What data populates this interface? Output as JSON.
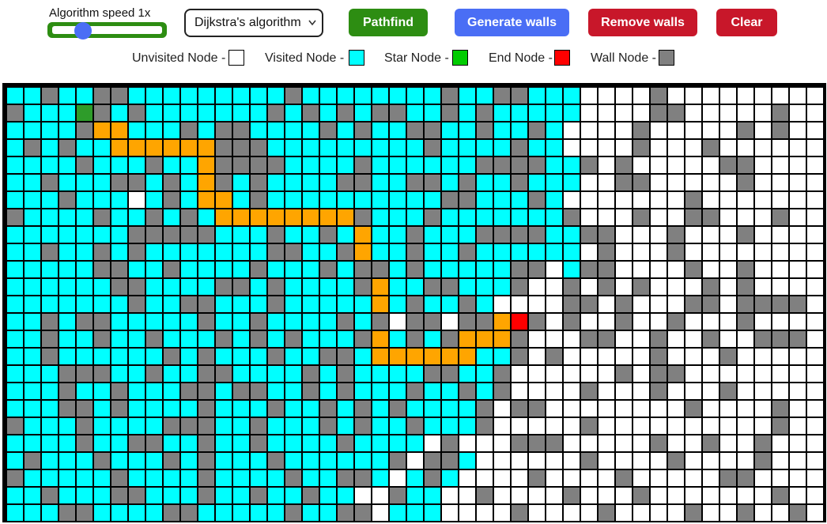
{
  "toolbar": {
    "speed_label": "Algorithm speed 1x",
    "speed_value": 0.25,
    "algorithm_selected": "Dijkstra's algorithm",
    "pathfind_label": "Pathfind",
    "generate_walls_label": "Generate walls",
    "remove_walls_label": "Remove walls",
    "clear_label": "Clear"
  },
  "legend": {
    "unvisited": "Unvisited Node -",
    "visited": "Visited Node -",
    "star": "Star Node -",
    "end": "End Node -",
    "wall": "Wall Node -"
  },
  "colors": {
    "unvisited": "#ffffff",
    "visited": "#00ffff",
    "star": "#00cc00",
    "start_cell": "#2e9c2a",
    "end": "#ff0000",
    "wall": "#808080",
    "path": "#ffa500",
    "pathfind_button": "#2d8d12",
    "generate_button": "#4a6ef5",
    "remove_button": "#c8172a",
    "clear_button": "#c8172a"
  },
  "grid": {
    "columns": 47,
    "rows": 25,
    "start": [
      1,
      4
    ],
    "end": [
      13,
      29
    ],
    "path": [
      [
        1,
        5
      ],
      [
        2,
        5
      ],
      [
        2,
        6
      ],
      [
        3,
        6
      ],
      [
        3,
        7
      ],
      [
        3,
        8
      ],
      [
        3,
        9
      ],
      [
        3,
        10
      ],
      [
        3,
        11
      ],
      [
        4,
        11
      ],
      [
        5,
        11
      ],
      [
        6,
        11
      ],
      [
        6,
        12
      ],
      [
        7,
        12
      ],
      [
        7,
        13
      ],
      [
        7,
        14
      ],
      [
        7,
        15
      ],
      [
        7,
        16
      ],
      [
        7,
        17
      ],
      [
        7,
        18
      ],
      [
        7,
        19
      ],
      [
        7,
        20
      ],
      [
        8,
        20
      ],
      [
        9,
        20
      ],
      [
        10,
        20
      ],
      [
        11,
        20
      ],
      [
        11,
        21
      ],
      [
        12,
        21
      ],
      [
        13,
        21
      ],
      [
        14,
        21
      ],
      [
        15,
        21
      ],
      [
        15,
        22
      ],
      [
        15,
        23
      ],
      [
        15,
        24
      ],
      [
        15,
        25
      ],
      [
        15,
        26
      ],
      [
        14,
        26
      ],
      [
        14,
        27
      ],
      [
        14,
        28
      ],
      [
        13,
        28
      ]
    ],
    "walls": [
      [
        0,
        2
      ],
      [
        0,
        5
      ],
      [
        0,
        6
      ],
      [
        0,
        16
      ],
      [
        0,
        25
      ],
      [
        0,
        28
      ],
      [
        0,
        29
      ],
      [
        0,
        37
      ],
      [
        1,
        0
      ],
      [
        1,
        5
      ],
      [
        1,
        7
      ],
      [
        1,
        15
      ],
      [
        1,
        17
      ],
      [
        1,
        19
      ],
      [
        1,
        21
      ],
      [
        1,
        22
      ],
      [
        1,
        25
      ],
      [
        1,
        27
      ],
      [
        1,
        37
      ],
      [
        1,
        38
      ],
      [
        1,
        44
      ],
      [
        2,
        4
      ],
      [
        2,
        10
      ],
      [
        2,
        12
      ],
      [
        2,
        13
      ],
      [
        2,
        18
      ],
      [
        2,
        20
      ],
      [
        2,
        23
      ],
      [
        2,
        24
      ],
      [
        2,
        27
      ],
      [
        2,
        30
      ],
      [
        2,
        36
      ],
      [
        2,
        42
      ],
      [
        2,
        44
      ],
      [
        3,
        1
      ],
      [
        3,
        3
      ],
      [
        3,
        12
      ],
      [
        3,
        13
      ],
      [
        3,
        14
      ],
      [
        3,
        24
      ],
      [
        3,
        29
      ],
      [
        3,
        36
      ],
      [
        3,
        40
      ],
      [
        4,
        4
      ],
      [
        4,
        8
      ],
      [
        4,
        12
      ],
      [
        4,
        13
      ],
      [
        4,
        14
      ],
      [
        4,
        15
      ],
      [
        4,
        20
      ],
      [
        4,
        27
      ],
      [
        4,
        28
      ],
      [
        4,
        29
      ],
      [
        4,
        30
      ],
      [
        4,
        33
      ],
      [
        4,
        35
      ],
      [
        4,
        41
      ],
      [
        4,
        42
      ],
      [
        5,
        2
      ],
      [
        5,
        6
      ],
      [
        5,
        7
      ],
      [
        5,
        9
      ],
      [
        5,
        12
      ],
      [
        5,
        14
      ],
      [
        5,
        19
      ],
      [
        5,
        20
      ],
      [
        5,
        23
      ],
      [
        5,
        24
      ],
      [
        5,
        26
      ],
      [
        5,
        29
      ],
      [
        5,
        35
      ],
      [
        5,
        36
      ],
      [
        5,
        42
      ],
      [
        6,
        3
      ],
      [
        6,
        9
      ],
      [
        6,
        14
      ],
      [
        6,
        25
      ],
      [
        6,
        26
      ],
      [
        6,
        30
      ],
      [
        6,
        39
      ],
      [
        7,
        0
      ],
      [
        7,
        5
      ],
      [
        7,
        8
      ],
      [
        7,
        10
      ],
      [
        7,
        20
      ],
      [
        7,
        24
      ],
      [
        7,
        32
      ],
      [
        7,
        36
      ],
      [
        7,
        39
      ],
      [
        7,
        40
      ],
      [
        7,
        44
      ],
      [
        8,
        7
      ],
      [
        8,
        8
      ],
      [
        8,
        9
      ],
      [
        8,
        10
      ],
      [
        8,
        11
      ],
      [
        8,
        15
      ],
      [
        8,
        18
      ],
      [
        8,
        23
      ],
      [
        8,
        27
      ],
      [
        8,
        28
      ],
      [
        8,
        29
      ],
      [
        8,
        30
      ],
      [
        8,
        33
      ],
      [
        8,
        34
      ],
      [
        8,
        38
      ],
      [
        8,
        42
      ],
      [
        9,
        2
      ],
      [
        9,
        5
      ],
      [
        9,
        7
      ],
      [
        9,
        15
      ],
      [
        9,
        16
      ],
      [
        9,
        19
      ],
      [
        9,
        23
      ],
      [
        9,
        26
      ],
      [
        9,
        34
      ],
      [
        9,
        38
      ],
      [
        10,
        5
      ],
      [
        10,
        6
      ],
      [
        10,
        9
      ],
      [
        10,
        14
      ],
      [
        10,
        18
      ],
      [
        10,
        20
      ],
      [
        10,
        21
      ],
      [
        10,
        23
      ],
      [
        10,
        29
      ],
      [
        10,
        30
      ],
      [
        10,
        33
      ],
      [
        10,
        34
      ],
      [
        10,
        39
      ],
      [
        10,
        42
      ],
      [
        11,
        6
      ],
      [
        11,
        7
      ],
      [
        11,
        12
      ],
      [
        11,
        13
      ],
      [
        11,
        15
      ],
      [
        11,
        20
      ],
      [
        11,
        24
      ],
      [
        11,
        25
      ],
      [
        11,
        29
      ],
      [
        11,
        32
      ],
      [
        11,
        34
      ],
      [
        11,
        36
      ],
      [
        11,
        40
      ],
      [
        11,
        42
      ],
      [
        12,
        7
      ],
      [
        12,
        10
      ],
      [
        12,
        11
      ],
      [
        12,
        15
      ],
      [
        12,
        23
      ],
      [
        12,
        26
      ],
      [
        12,
        32
      ],
      [
        12,
        33
      ],
      [
        12,
        35
      ],
      [
        12,
        39
      ],
      [
        12,
        40
      ],
      [
        12,
        42
      ],
      [
        12,
        43
      ],
      [
        12,
        44
      ],
      [
        12,
        45
      ],
      [
        13,
        2
      ],
      [
        13,
        4
      ],
      [
        13,
        5
      ],
      [
        13,
        11
      ],
      [
        13,
        14
      ],
      [
        13,
        19
      ],
      [
        13,
        21
      ],
      [
        13,
        23
      ],
      [
        13,
        24
      ],
      [
        13,
        26
      ],
      [
        13,
        27
      ],
      [
        13,
        30
      ],
      [
        13,
        32
      ],
      [
        13,
        35
      ],
      [
        13,
        38
      ],
      [
        13,
        42
      ],
      [
        14,
        2
      ],
      [
        14,
        5
      ],
      [
        14,
        8
      ],
      [
        14,
        12
      ],
      [
        14,
        14
      ],
      [
        14,
        16
      ],
      [
        14,
        20
      ],
      [
        14,
        23
      ],
      [
        14,
        25
      ],
      [
        14,
        29
      ],
      [
        14,
        33
      ],
      [
        14,
        34
      ],
      [
        14,
        37
      ],
      [
        14,
        40
      ],
      [
        14,
        43
      ],
      [
        14,
        44
      ],
      [
        14,
        45
      ],
      [
        15,
        2
      ],
      [
        15,
        9
      ],
      [
        15,
        11
      ],
      [
        15,
        15
      ],
      [
        15,
        18
      ],
      [
        15,
        19
      ],
      [
        15,
        29
      ],
      [
        15,
        31
      ],
      [
        15,
        37
      ],
      [
        15,
        41
      ],
      [
        16,
        3
      ],
      [
        16,
        4
      ],
      [
        16,
        5
      ],
      [
        16,
        8
      ],
      [
        16,
        11
      ],
      [
        16,
        12
      ],
      [
        16,
        17
      ],
      [
        16,
        19
      ],
      [
        16,
        24
      ],
      [
        16,
        25
      ],
      [
        16,
        28
      ],
      [
        16,
        35
      ],
      [
        16,
        37
      ],
      [
        16,
        38
      ],
      [
        17,
        3
      ],
      [
        17,
        6
      ],
      [
        17,
        10
      ],
      [
        17,
        11
      ],
      [
        17,
        13
      ],
      [
        17,
        14
      ],
      [
        17,
        17
      ],
      [
        17,
        19
      ],
      [
        17,
        23
      ],
      [
        17,
        26
      ],
      [
        17,
        28
      ],
      [
        17,
        33
      ],
      [
        17,
        37
      ],
      [
        17,
        41
      ],
      [
        18,
        3
      ],
      [
        18,
        4
      ],
      [
        18,
        6
      ],
      [
        18,
        11
      ],
      [
        18,
        15
      ],
      [
        18,
        18
      ],
      [
        18,
        20
      ],
      [
        18,
        22
      ],
      [
        18,
        27
      ],
      [
        18,
        29
      ],
      [
        18,
        30
      ],
      [
        18,
        39
      ],
      [
        18,
        44
      ],
      [
        19,
        0
      ],
      [
        19,
        4
      ],
      [
        19,
        9
      ],
      [
        19,
        10
      ],
      [
        19,
        11
      ],
      [
        19,
        14
      ],
      [
        19,
        18
      ],
      [
        19,
        20
      ],
      [
        19,
        23
      ],
      [
        19,
        27
      ],
      [
        19,
        33
      ],
      [
        19,
        44
      ],
      [
        20,
        4
      ],
      [
        20,
        7
      ],
      [
        20,
        8
      ],
      [
        20,
        11
      ],
      [
        20,
        14
      ],
      [
        20,
        19
      ],
      [
        20,
        25
      ],
      [
        20,
        29
      ],
      [
        20,
        30
      ],
      [
        20,
        31
      ],
      [
        20,
        37
      ],
      [
        20,
        40
      ],
      [
        20,
        43
      ],
      [
        21,
        1
      ],
      [
        21,
        5
      ],
      [
        21,
        9
      ],
      [
        21,
        11
      ],
      [
        21,
        15
      ],
      [
        21,
        22
      ],
      [
        21,
        24
      ],
      [
        21,
        25
      ],
      [
        21,
        33
      ],
      [
        21,
        38
      ],
      [
        21,
        43
      ],
      [
        22,
        0
      ],
      [
        22,
        6
      ],
      [
        22,
        11
      ],
      [
        22,
        16
      ],
      [
        22,
        19
      ],
      [
        22,
        20
      ],
      [
        22,
        24
      ],
      [
        22,
        30
      ],
      [
        22,
        35
      ],
      [
        22,
        41
      ],
      [
        22,
        42
      ],
      [
        23,
        2
      ],
      [
        23,
        6
      ],
      [
        23,
        7
      ],
      [
        23,
        11
      ],
      [
        23,
        14
      ],
      [
        23,
        17
      ],
      [
        23,
        22
      ],
      [
        23,
        27
      ],
      [
        23,
        32
      ],
      [
        23,
        36
      ],
      [
        23,
        44
      ],
      [
        24,
        3
      ],
      [
        24,
        4
      ],
      [
        24,
        9
      ],
      [
        24,
        10
      ],
      [
        24,
        16
      ],
      [
        24,
        19
      ],
      [
        24,
        20
      ],
      [
        24,
        29
      ],
      [
        24,
        34
      ],
      [
        24,
        39
      ],
      [
        24,
        42
      ],
      [
        24,
        45
      ]
    ],
    "unvisited": [
      [
        3,
        32
      ],
      [
        4,
        34
      ],
      [
        5,
        33
      ],
      [
        6,
        7
      ],
      [
        6,
        33
      ],
      [
        7,
        33
      ],
      [
        8,
        35
      ],
      [
        9,
        33
      ],
      [
        9,
        35
      ],
      [
        10,
        31
      ],
      [
        10,
        35
      ],
      [
        11,
        7
      ],
      [
        11,
        30
      ],
      [
        11,
        31
      ],
      [
        12,
        30
      ],
      [
        13,
        22
      ],
      [
        13,
        25
      ],
      [
        14,
        28
      ],
      [
        15,
        30
      ],
      [
        16,
        29
      ],
      [
        16,
        30
      ],
      [
        17,
        29
      ],
      [
        17,
        30
      ],
      [
        18,
        28
      ],
      [
        20,
        24
      ],
      [
        20,
        26
      ],
      [
        21,
        23
      ],
      [
        21,
        27
      ],
      [
        22,
        22
      ],
      [
        23,
        20
      ],
      [
        23,
        21
      ],
      [
        24,
        21
      ]
    ],
    "visited_limit_by_row": [
      32,
      32,
      31,
      31,
      32,
      32,
      31,
      32,
      32,
      32,
      32,
      29,
      27,
      27,
      28,
      28,
      28,
      28,
      27,
      26,
      26,
      26,
      25,
      24,
      24
    ]
  }
}
